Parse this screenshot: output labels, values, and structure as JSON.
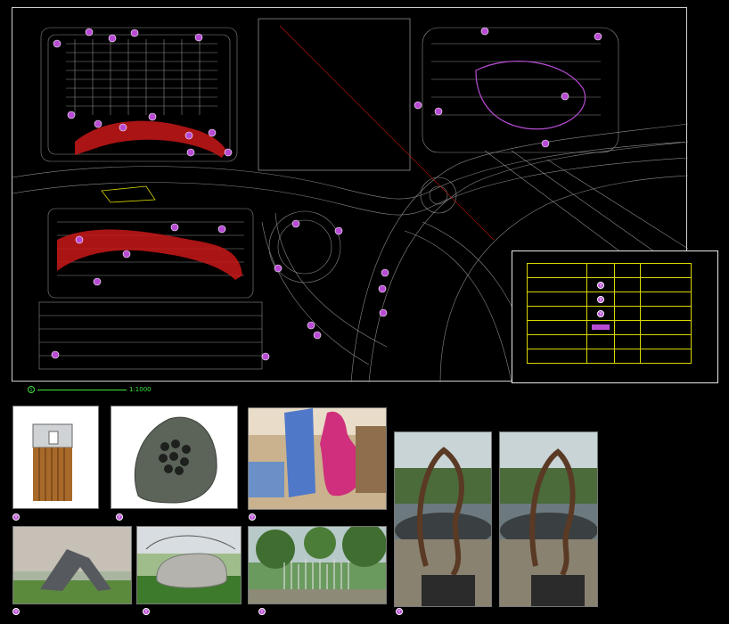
{
  "colors": {
    "background": "#000000",
    "plan_lines": "#8c8c8c",
    "marker": "#b84bd4",
    "red_paving": "#c81818",
    "legend_grid": "#d8d800",
    "title_green": "#3ce63c"
  },
  "legend": {
    "rows": [
      {
        "name": "",
        "qty": "",
        "note": ""
      },
      {
        "name": "",
        "qty": "",
        "note": ""
      },
      {
        "name": "",
        "qty": "",
        "note": ""
      },
      {
        "name": "",
        "qty": "",
        "note": ""
      },
      {
        "name": "",
        "qty": "",
        "note": ""
      },
      {
        "name": "",
        "qty": "",
        "note": ""
      },
      {
        "name": "",
        "qty": "",
        "note": ""
      }
    ]
  },
  "drawing_title": {
    "number": "1",
    "scale": "1:1000"
  },
  "photos": [
    {
      "caption": "",
      "icon": "trash-bin-photo"
    },
    {
      "caption": "",
      "icon": "rock-speaker-photo"
    },
    {
      "caption": "",
      "icon": "sign-board-photo"
    },
    {
      "caption": "",
      "icon": "sculpture-photo-1"
    },
    {
      "caption": "",
      "icon": "sculpture-photo-2"
    },
    {
      "caption": "",
      "icon": "gate-sculpture-photo"
    },
    {
      "caption": "",
      "icon": "stone-entrance-photo"
    },
    {
      "caption": "",
      "icon": "pole-installation-photo"
    }
  ]
}
